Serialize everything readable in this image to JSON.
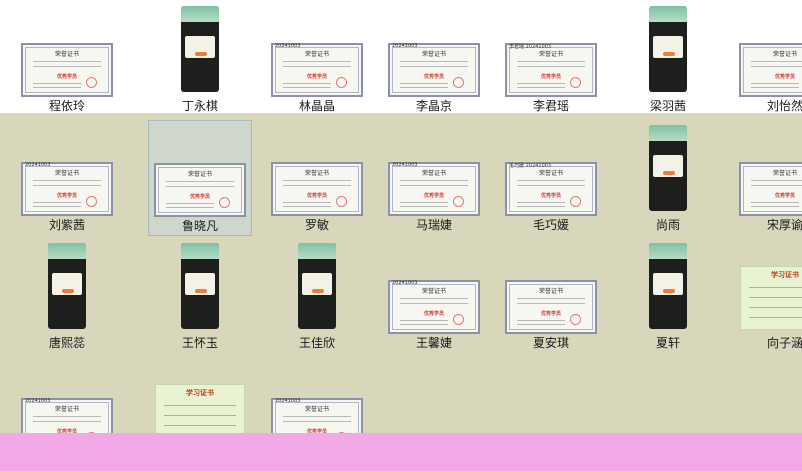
{
  "row1": [
    {
      "name": "程依玲",
      "kind": "cert",
      "cert_title": "荣誉证书",
      "award": "优秀学员"
    },
    {
      "name": "丁永棋",
      "kind": "phone"
    },
    {
      "name": "林晶晶",
      "kind": "cert",
      "cert_title": "荣誉证书",
      "award": "优秀学员",
      "number": "20241003"
    },
    {
      "name": "李晶京",
      "kind": "cert",
      "cert_title": "荣誉证书",
      "award": "优秀学员",
      "number": "20241003"
    },
    {
      "name": "李君瑶",
      "kind": "cert",
      "cert_title": "荣誉证书",
      "award": "优秀学员",
      "number": "李君瑶 20241003"
    },
    {
      "name": "梁羽茜",
      "kind": "phone"
    },
    {
      "name": "刘怡然",
      "kind": "cert",
      "cert_title": "荣誉证书",
      "award": "优秀学员"
    }
  ],
  "row2": [
    {
      "name": "刘紫茜",
      "kind": "cert",
      "cert_title": "荣誉证书",
      "award": "优秀学员",
      "number": "20241003"
    },
    {
      "name": "鲁晓凡",
      "kind": "cert",
      "cert_title": "荣誉证书",
      "award": "优秀学员",
      "selected": true
    },
    {
      "name": "罗敏",
      "kind": "cert",
      "cert_title": "荣誉证书",
      "award": "优秀学员"
    },
    {
      "name": "马瑞婕",
      "kind": "cert",
      "cert_title": "荣誉证书",
      "award": "优秀学员",
      "number": "20241003"
    },
    {
      "name": "毛巧媛",
      "kind": "cert",
      "cert_title": "荣誉证书",
      "award": "优秀学员",
      "number": "毛巧媛 20241003"
    },
    {
      "name": "尚雨",
      "kind": "phone"
    },
    {
      "name": "宋厚谕",
      "kind": "cert",
      "cert_title": "荣誉证书",
      "award": "优秀学员"
    }
  ],
  "row3": [
    {
      "name": "唐熙蕊",
      "kind": "phone"
    },
    {
      "name": "王怀玉",
      "kind": "phone"
    },
    {
      "name": "王佳欣",
      "kind": "phone"
    },
    {
      "name": "王馨婕",
      "kind": "cert",
      "cert_title": "荣誉证书",
      "award": "优秀学员",
      "number": "20241003"
    },
    {
      "name": "夏安琪",
      "kind": "cert",
      "cert_title": "荣誉证书",
      "award": "优秀学员"
    },
    {
      "name": "夏轩",
      "kind": "phone"
    },
    {
      "name": "向子涵",
      "kind": "study",
      "cert_title": "学习证书"
    }
  ],
  "row4": [
    {
      "kind": "cert",
      "cert_title": "荣誉证书",
      "award": "优秀学员",
      "number": "20241003"
    },
    {
      "kind": "study",
      "cert_title": "学习证书"
    },
    {
      "kind": "cert",
      "cert_title": "荣誉证书",
      "award": "优秀学员",
      "number": "20241003"
    }
  ],
  "colors": {
    "background": "#d8d7bb",
    "selected": "#c8d7d7",
    "bottom_band": "#f2a8e6",
    "award_red": "#d1403a"
  }
}
